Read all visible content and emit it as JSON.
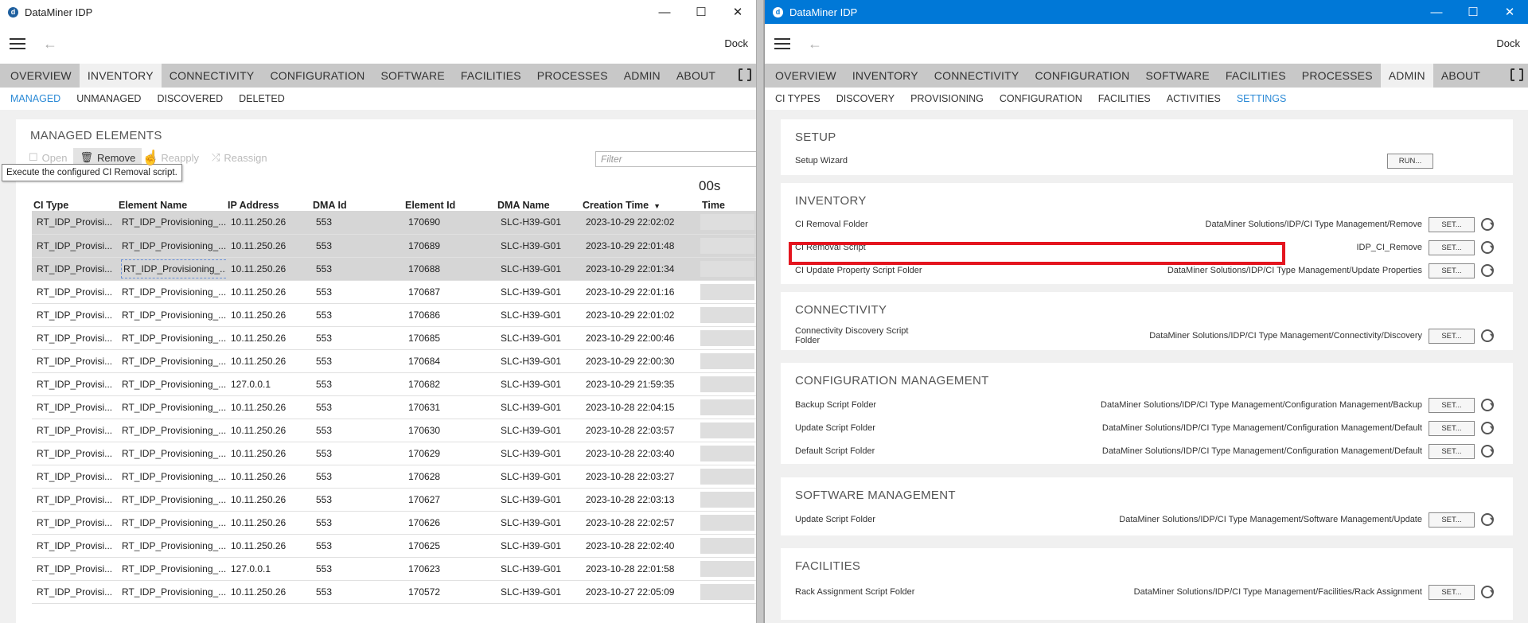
{
  "left": {
    "app_title": "DataMiner IDP",
    "dock_label": "Dock",
    "main_tabs": [
      "OVERVIEW",
      "INVENTORY",
      "CONNECTIVITY",
      "CONFIGURATION",
      "SOFTWARE",
      "FACILITIES",
      "PROCESSES",
      "ADMIN",
      "ABOUT"
    ],
    "active_tab": "INVENTORY",
    "sub_tabs": [
      "MANAGED",
      "UNMANAGED",
      "DISCOVERED",
      "DELETED"
    ],
    "active_sub": "MANAGED",
    "section_title": "MANAGED ELEMENTS",
    "actions": {
      "open": "Open",
      "remove": "Remove",
      "reapply": "Reapply",
      "reassign": "Reassign"
    },
    "filter_placeholder": "Filter",
    "tooltip": "Execute the configured CI Removal script.",
    "time_info": "00s",
    "columns": [
      "CI Type",
      "Element Name",
      "IP Address",
      "DMA Id",
      "Element Id",
      "DMA Name",
      "Creation Time",
      "Time"
    ],
    "rows": [
      {
        "ci": "RT_IDP_Provisi...",
        "name": "RT_IDP_Provisioning_...",
        "ip": "10.11.250.26",
        "dma": "553",
        "eid": "170690",
        "dmaname": "SLC-H39-G01",
        "created": "2023-10-29 22:02:02",
        "selected": true
      },
      {
        "ci": "RT_IDP_Provisi...",
        "name": "RT_IDP_Provisioning_...",
        "ip": "10.11.250.26",
        "dma": "553",
        "eid": "170689",
        "dmaname": "SLC-H39-G01",
        "created": "2023-10-29 22:01:48",
        "selected": true
      },
      {
        "ci": "RT_IDP_Provisi...",
        "name": "RT_IDP_Provisioning_...",
        "ip": "10.11.250.26",
        "dma": "553",
        "eid": "170688",
        "dmaname": "SLC-H39-G01",
        "created": "2023-10-29 22:01:34",
        "selected": true,
        "focus": true
      },
      {
        "ci": "RT_IDP_Provisi...",
        "name": "RT_IDP_Provisioning_...",
        "ip": "10.11.250.26",
        "dma": "553",
        "eid": "170687",
        "dmaname": "SLC-H39-G01",
        "created": "2023-10-29 22:01:16"
      },
      {
        "ci": "RT_IDP_Provisi...",
        "name": "RT_IDP_Provisioning_...",
        "ip": "10.11.250.26",
        "dma": "553",
        "eid": "170686",
        "dmaname": "SLC-H39-G01",
        "created": "2023-10-29 22:01:02"
      },
      {
        "ci": "RT_IDP_Provisi...",
        "name": "RT_IDP_Provisioning_...",
        "ip": "10.11.250.26",
        "dma": "553",
        "eid": "170685",
        "dmaname": "SLC-H39-G01",
        "created": "2023-10-29 22:00:46"
      },
      {
        "ci": "RT_IDP_Provisi...",
        "name": "RT_IDP_Provisioning_...",
        "ip": "10.11.250.26",
        "dma": "553",
        "eid": "170684",
        "dmaname": "SLC-H39-G01",
        "created": "2023-10-29 22:00:30"
      },
      {
        "ci": "RT_IDP_Provisi...",
        "name": "RT_IDP_Provisioning_...",
        "ip": "127.0.0.1",
        "dma": "553",
        "eid": "170682",
        "dmaname": "SLC-H39-G01",
        "created": "2023-10-29 21:59:35"
      },
      {
        "ci": "RT_IDP_Provisi...",
        "name": "RT_IDP_Provisioning_...",
        "ip": "10.11.250.26",
        "dma": "553",
        "eid": "170631",
        "dmaname": "SLC-H39-G01",
        "created": "2023-10-28 22:04:15"
      },
      {
        "ci": "RT_IDP_Provisi...",
        "name": "RT_IDP_Provisioning_...",
        "ip": "10.11.250.26",
        "dma": "553",
        "eid": "170630",
        "dmaname": "SLC-H39-G01",
        "created": "2023-10-28 22:03:57"
      },
      {
        "ci": "RT_IDP_Provisi...",
        "name": "RT_IDP_Provisioning_...",
        "ip": "10.11.250.26",
        "dma": "553",
        "eid": "170629",
        "dmaname": "SLC-H39-G01",
        "created": "2023-10-28 22:03:40"
      },
      {
        "ci": "RT_IDP_Provisi...",
        "name": "RT_IDP_Provisioning_...",
        "ip": "10.11.250.26",
        "dma": "553",
        "eid": "170628",
        "dmaname": "SLC-H39-G01",
        "created": "2023-10-28 22:03:27"
      },
      {
        "ci": "RT_IDP_Provisi...",
        "name": "RT_IDP_Provisioning_...",
        "ip": "10.11.250.26",
        "dma": "553",
        "eid": "170627",
        "dmaname": "SLC-H39-G01",
        "created": "2023-10-28 22:03:13"
      },
      {
        "ci": "RT_IDP_Provisi...",
        "name": "RT_IDP_Provisioning_...",
        "ip": "10.11.250.26",
        "dma": "553",
        "eid": "170626",
        "dmaname": "SLC-H39-G01",
        "created": "2023-10-28 22:02:57"
      },
      {
        "ci": "RT_IDP_Provisi...",
        "name": "RT_IDP_Provisioning_...",
        "ip": "10.11.250.26",
        "dma": "553",
        "eid": "170625",
        "dmaname": "SLC-H39-G01",
        "created": "2023-10-28 22:02:40"
      },
      {
        "ci": "RT_IDP_Provisi...",
        "name": "RT_IDP_Provisioning_...",
        "ip": "127.0.0.1",
        "dma": "553",
        "eid": "170623",
        "dmaname": "SLC-H39-G01",
        "created": "2023-10-28 22:01:58"
      },
      {
        "ci": "RT_IDP_Provisi...",
        "name": "RT_IDP_Provisioning_...",
        "ip": "10.11.250.26",
        "dma": "553",
        "eid": "170572",
        "dmaname": "SLC-H39-G01",
        "created": "2023-10-27 22:05:09"
      }
    ]
  },
  "right": {
    "app_title": "DataMiner IDP",
    "dock_label": "Dock",
    "main_tabs": [
      "OVERVIEW",
      "INVENTORY",
      "CONNECTIVITY",
      "CONFIGURATION",
      "SOFTWARE",
      "FACILITIES",
      "PROCESSES",
      "ADMIN",
      "ABOUT"
    ],
    "active_tab": "ADMIN",
    "sub_tabs": [
      "CI TYPES",
      "DISCOVERY",
      "PROVISIONING",
      "CONFIGURATION",
      "FACILITIES",
      "ACTIVITIES",
      "SETTINGS"
    ],
    "active_sub": "SETTINGS",
    "set_label": "SET...",
    "run_label": "RUN...",
    "sections": {
      "setup": {
        "title": "SETUP",
        "rows": [
          {
            "label": "Setup Wizard",
            "value": ""
          }
        ]
      },
      "inventory": {
        "title": "INVENTORY",
        "rows": [
          {
            "label": "CI Removal Folder",
            "value": "DataMiner Solutions/IDP/CI Type Management/Remove"
          },
          {
            "label": "CI Removal Script",
            "value": "IDP_CI_Remove"
          },
          {
            "label": "CI Update Property Script Folder",
            "value": "DataMiner Solutions/IDP/CI Type Management/Update Properties"
          }
        ]
      },
      "connectivity": {
        "title": "CONNECTIVITY",
        "rows": [
          {
            "label": "Connectivity Discovery Script Folder",
            "value": "DataMiner Solutions/IDP/CI Type Management/Connectivity/Discovery"
          }
        ]
      },
      "configuration": {
        "title": "CONFIGURATION MANAGEMENT",
        "rows": [
          {
            "label": "Backup Script Folder",
            "value": "DataMiner Solutions/IDP/CI Type Management/Configuration Management/Backup"
          },
          {
            "label": "Update Script Folder",
            "value": "DataMiner Solutions/IDP/CI Type Management/Configuration Management/Default"
          },
          {
            "label": "Default Script Folder",
            "value": "DataMiner Solutions/IDP/CI Type Management/Configuration Management/Default"
          }
        ]
      },
      "software": {
        "title": "SOFTWARE MANAGEMENT",
        "rows": [
          {
            "label": "Update Script Folder",
            "value": "DataMiner Solutions/IDP/CI Type Management/Software Management/Update"
          }
        ]
      },
      "facilities": {
        "title": "FACILITIES",
        "rows": [
          {
            "label": "Rack Assignment Script Folder",
            "value": "DataMiner Solutions/IDP/CI Type Management/Facilities/Rack Assignment"
          }
        ]
      }
    }
  }
}
